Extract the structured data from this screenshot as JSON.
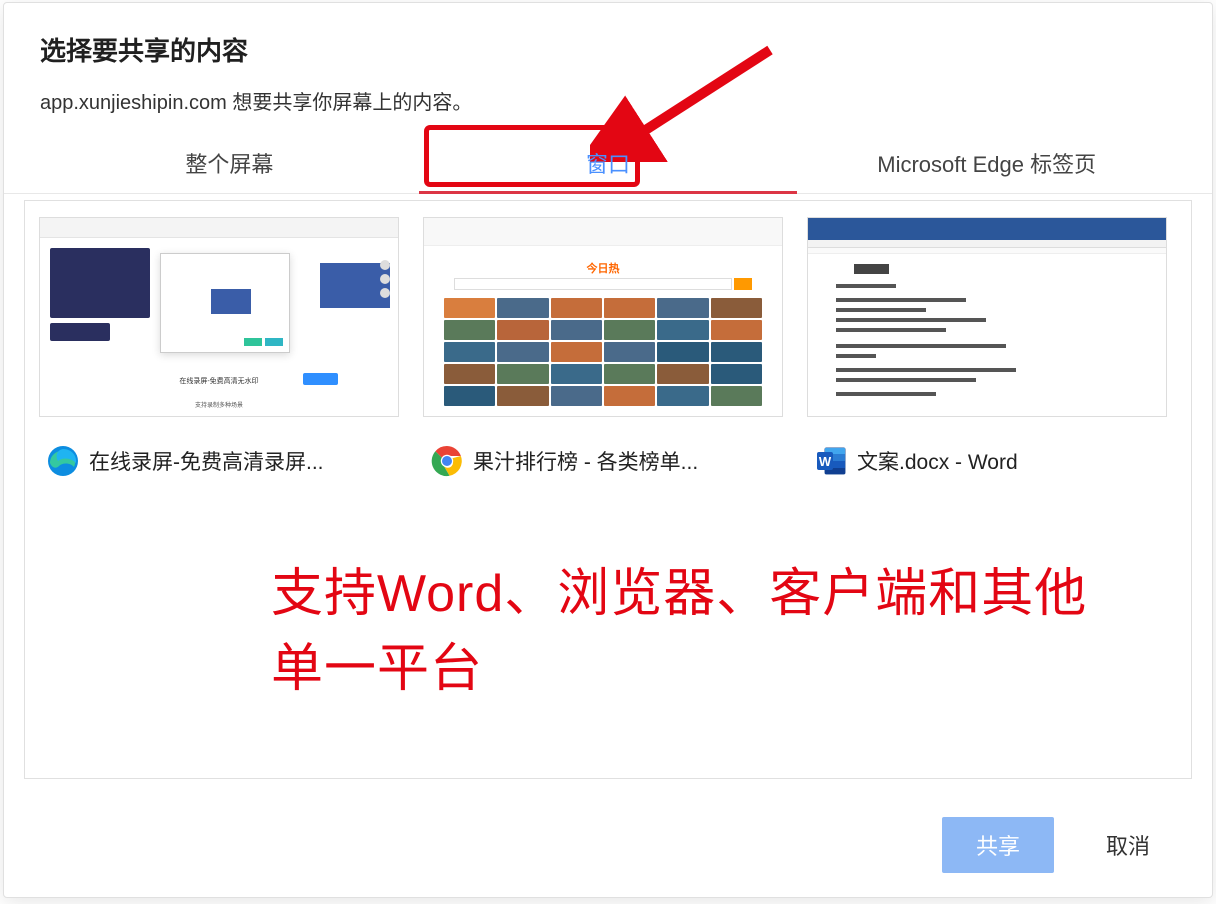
{
  "dialog": {
    "title": "选择要共享的内容",
    "subtitle": "app.xunjieshipin.com 想要共享你屏幕上的内容。"
  },
  "tabs": {
    "items": [
      {
        "label": "整个屏幕",
        "active": false
      },
      {
        "label": "窗口",
        "active": true
      },
      {
        "label": "Microsoft Edge 标签页",
        "active": false
      }
    ]
  },
  "windows": [
    {
      "app": "edge",
      "name": "在线录屏-免费高清录屏..."
    },
    {
      "app": "chrome",
      "name": "果汁排行榜 - 各类榜单..."
    },
    {
      "app": "word",
      "name": "文案.docx - Word"
    }
  ],
  "annotation": {
    "text": "支持Word、浏览器、客户端和其他单一平台"
  },
  "footer": {
    "share": "共享",
    "cancel": "取消"
  },
  "thumb2_logo": "今日热"
}
